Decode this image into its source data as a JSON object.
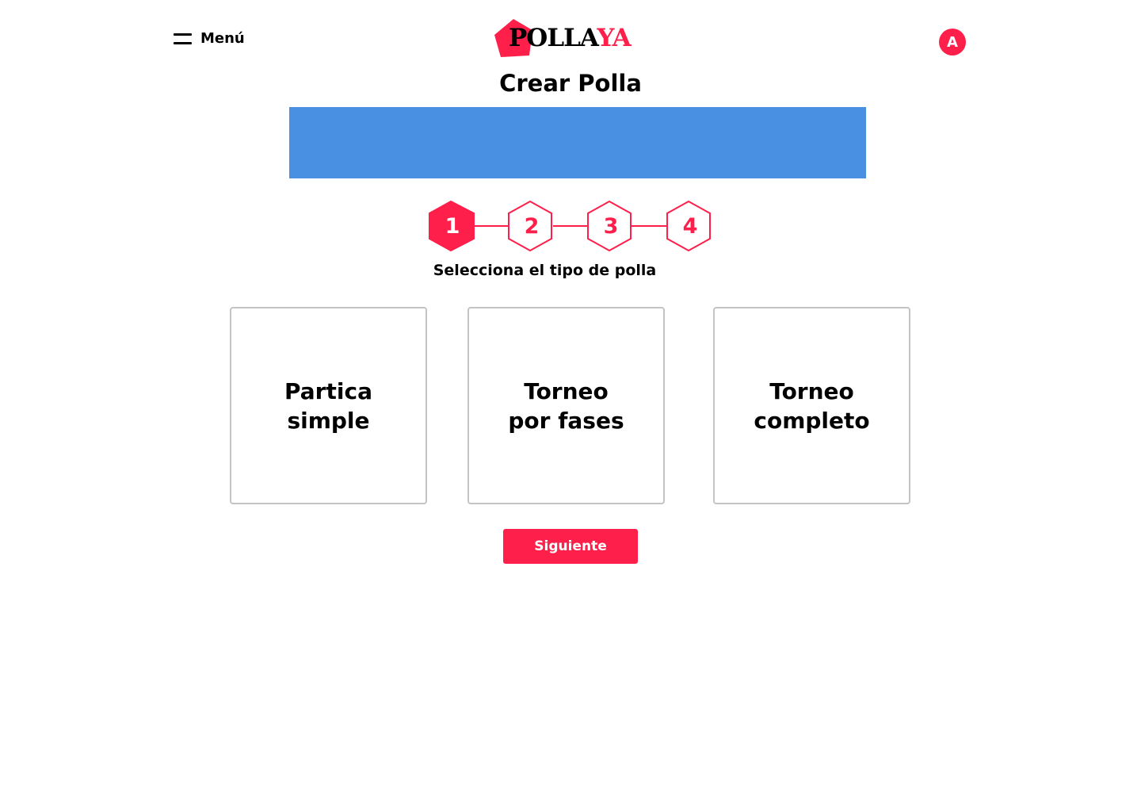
{
  "header": {
    "menu_label": "Menú",
    "logo": {
      "text_dark": "POLLA",
      "text_accent": "YA"
    },
    "avatar_initial": "A"
  },
  "page": {
    "title": "Crear Polla",
    "subtitle": "Selecciona el tipo de polla"
  },
  "stepper": {
    "current": 1,
    "steps": [
      "1",
      "2",
      "3",
      "4"
    ]
  },
  "options": [
    {
      "line1": "Partica",
      "line2": "simple"
    },
    {
      "line1": "Torneo",
      "line2": "por fases"
    },
    {
      "line1": "Torneo",
      "line2": "completo"
    }
  ],
  "actions": {
    "next_label": "Siguiente"
  },
  "colors": {
    "accent": "#ff1f4b",
    "banner": "#4a90e2",
    "card_border": "#c4c4c4"
  },
  "icons": {
    "menu": "hamburger-icon",
    "logo": "pentagon-logo-icon"
  }
}
